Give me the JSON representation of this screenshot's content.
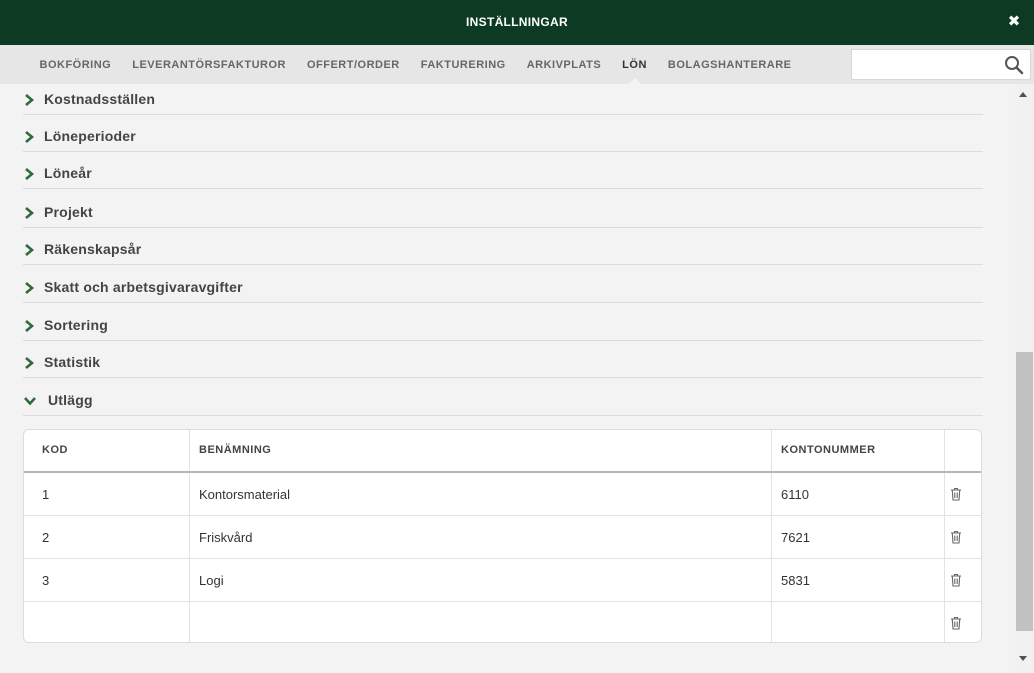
{
  "window": {
    "title": "INSTÄLLNINGAR",
    "close_icon": "close-icon"
  },
  "nav": {
    "tabs": [
      {
        "label": "BOKFÖRING"
      },
      {
        "label": "LEVERANTÖRSFAKTUROR"
      },
      {
        "label": "OFFERT/ORDER"
      },
      {
        "label": "FAKTURERING"
      },
      {
        "label": "ARKIVPLATS"
      },
      {
        "label": "LÖN",
        "active": true
      },
      {
        "label": "BOLAGSHANTERARE"
      }
    ],
    "search": {
      "placeholder": "",
      "value": "",
      "icon": "search-icon"
    }
  },
  "sections": [
    {
      "label": "Kostnadsställen",
      "state": "collapsed"
    },
    {
      "label": "Löneperioder",
      "state": "collapsed"
    },
    {
      "label": "Löneår",
      "state": "collapsed"
    },
    {
      "label": "Projekt",
      "state": "collapsed"
    },
    {
      "label": "Räkenskapsår",
      "state": "collapsed"
    },
    {
      "label": "Skatt och arbetsgivaravgifter",
      "state": "collapsed"
    },
    {
      "label": "Sortering",
      "state": "collapsed"
    },
    {
      "label": "Statistik",
      "state": "collapsed"
    },
    {
      "label": "Utlägg",
      "state": "expanded"
    }
  ],
  "utlagg_table": {
    "columns": [
      "KOD",
      "BENÄMNING",
      "KONTONUMMER",
      ""
    ],
    "rows": [
      {
        "kod": "1",
        "benamning": "Kontorsmaterial",
        "kontonummer": "6110"
      },
      {
        "kod": "2",
        "benamning": "Friskvård",
        "kontonummer": "7621"
      },
      {
        "kod": "3",
        "benamning": "Logi",
        "kontonummer": "5831"
      },
      {
        "kod": "",
        "benamning": "",
        "kontonummer": ""
      }
    ],
    "row_action_icon": "trash-icon"
  },
  "colors": {
    "header_bg": "#0d3a23",
    "accent_green": "#2f6b3a",
    "nav_bg": "#e6e6e6",
    "page_bg": "#f3f3f3"
  }
}
